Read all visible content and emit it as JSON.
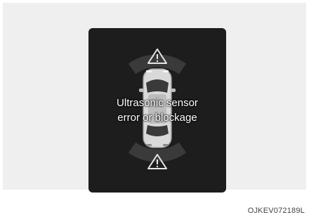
{
  "display": {
    "message_line1": "Ultrasonic sensor",
    "message_line2": "error or blockage",
    "front_indicator_icon": "warning-triangle",
    "rear_indicator_icon": "warning-triangle"
  },
  "figure_code": "OJKEV072189L",
  "colors": {
    "screen_bg": "#1d1d1d",
    "panel_bg": "#efefef",
    "text": "#ffffff"
  }
}
